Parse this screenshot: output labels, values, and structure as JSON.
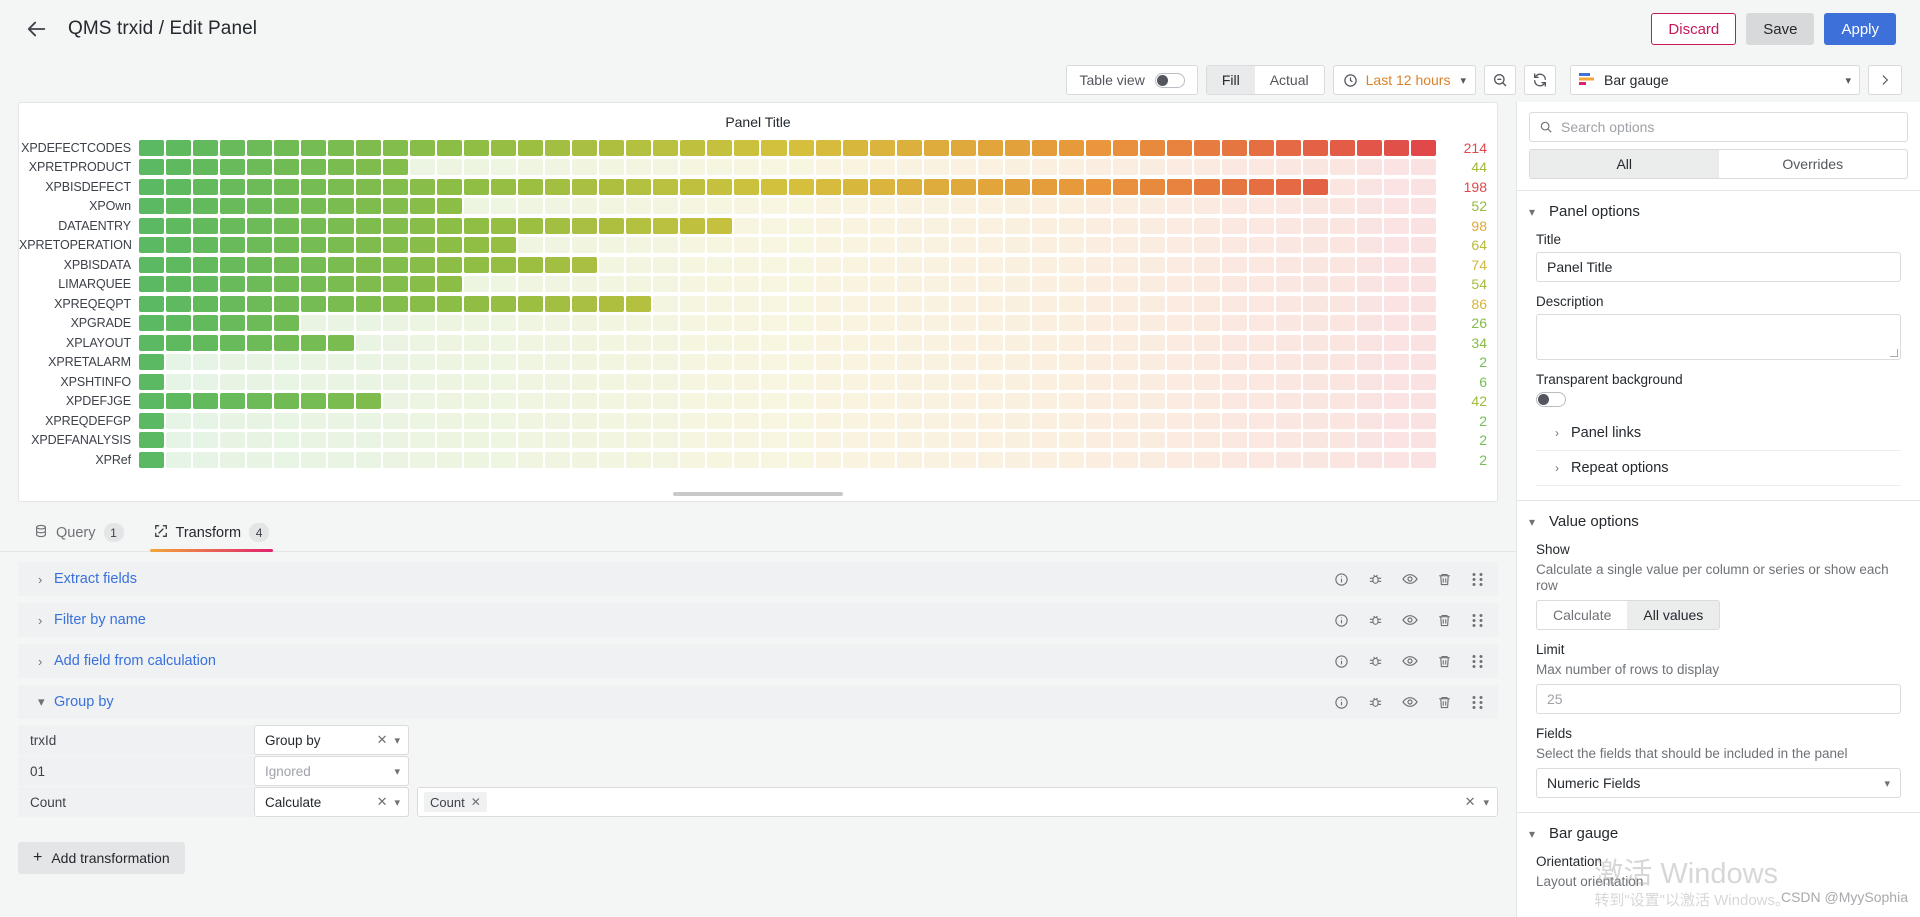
{
  "header": {
    "back_icon": "arrow-left-icon",
    "title": "QMS trxid / Edit Panel",
    "discard_label": "Discard",
    "save_label": "Save",
    "apply_label": "Apply"
  },
  "toolbar": {
    "table_view_label": "Table view",
    "table_view_on": false,
    "fill_label": "Fill",
    "actual_label": "Actual",
    "fill_active": true,
    "time_range_label": "Last 12 hours",
    "clock_icon": "clock-icon",
    "zoom_out_icon": "zoom-out-icon",
    "refresh_icon": "refresh-icon",
    "viz_name": "Bar gauge",
    "viz_icon": "bar-gauge-icon",
    "next_icon": "chevron-right-icon"
  },
  "panel": {
    "title": "Panel Title"
  },
  "chart_data": {
    "type": "bar",
    "title": "Panel Title",
    "xlabel": "",
    "ylabel": "",
    "orientation": "horizontal",
    "display": "retro-lcd-bar-gauge",
    "cell_count": 48,
    "max_value": 214,
    "categories": [
      "XPDEFECTCODES",
      "XPRETPRODUCT",
      "XPBISDEFECT",
      "XPOwn",
      "DATAENTRY",
      "XPRETOPERATION",
      "XPBISDATA",
      "LIMARQUEE",
      "XPREQEQPT",
      "XPGRADE",
      "XPLAYOUT",
      "XPRETALARM",
      "XPSHTINFO",
      "XPDEFJGE",
      "XPREQDEFGP",
      "XPDEFANALYSIS",
      "XPRef"
    ],
    "values": [
      214,
      44,
      198,
      52,
      98,
      64,
      74,
      54,
      86,
      26,
      34,
      2,
      6,
      42,
      2,
      2,
      2
    ],
    "value_colors": [
      "#e0484a",
      "#a2b93a",
      "#e0484a",
      "#90bc42",
      "#e2a93a",
      "#b5bb38",
      "#cfb73a",
      "#a8ba39",
      "#d7b63a",
      "#85bb47",
      "#88bb45",
      "#73bf55",
      "#74bf54",
      "#9cbb3c",
      "#73bf55",
      "#73bf55",
      "#73bf55"
    ],
    "gradient": [
      "#5ab962",
      "#8fbe44",
      "#d4c13c",
      "#e9953c",
      "#e0484a"
    ]
  },
  "tabs": [
    {
      "label": "Query",
      "badge": "1",
      "icon": "database-icon",
      "active": false
    },
    {
      "label": "Transform",
      "badge": "4",
      "icon": "transform-icon",
      "active": true
    }
  ],
  "transformations": [
    {
      "name": "Extract fields",
      "expanded": false
    },
    {
      "name": "Filter by name",
      "expanded": false
    },
    {
      "name": "Add field from calculation",
      "expanded": false
    },
    {
      "name": "Group by",
      "expanded": true
    }
  ],
  "transform_row_icons": [
    "info-icon",
    "debug-icon",
    "eye-icon",
    "trash-icon",
    "drag-handle-icon"
  ],
  "group_by": {
    "rows": [
      {
        "field": "trxId",
        "operation": "Group by",
        "placeholder": false,
        "has_clear": true,
        "chips": []
      },
      {
        "field": "01",
        "operation": "Ignored",
        "placeholder": true,
        "has_clear": false,
        "chips": []
      },
      {
        "field": "Count",
        "operation": "Calculate",
        "placeholder": false,
        "has_clear": true,
        "chips": [
          "Count"
        ]
      }
    ]
  },
  "add_transformation_label": "Add transformation",
  "options": {
    "search_placeholder": "Search options",
    "tabs": {
      "all": "All",
      "overrides": "Overrides",
      "active": "All"
    },
    "panel_options": {
      "heading": "Panel options",
      "title_label": "Title",
      "title_value": "Panel Title",
      "description_label": "Description",
      "description_value": "",
      "transparent_label": "Transparent background",
      "transparent_on": false,
      "panel_links": "Panel links",
      "repeat_options": "Repeat options"
    },
    "value_options": {
      "heading": "Value options",
      "show_label": "Show",
      "show_desc": "Calculate a single value per column or series or show each row",
      "calculate_label": "Calculate",
      "all_values_label": "All values",
      "active_show": "All values",
      "limit_label": "Limit",
      "limit_desc": "Max number of rows to display",
      "limit_value": "25",
      "fields_label": "Fields",
      "fields_desc": "Select the fields that should be included in the panel",
      "fields_value": "Numeric Fields"
    },
    "bar_gauge": {
      "heading": "Bar gauge",
      "orientation_label": "Orientation",
      "orientation_desc": "Layout orientation"
    }
  },
  "watermark": {
    "line1": "激活 Windows",
    "line2": "转到\"设置\"以激活 Windows。",
    "credit": "CSDN @MyySophia"
  },
  "colors": {
    "accent_blue": "#3d71d9",
    "link_blue": "#3871dc",
    "discard_pink": "#c7175b",
    "orange": "#d9822b"
  }
}
